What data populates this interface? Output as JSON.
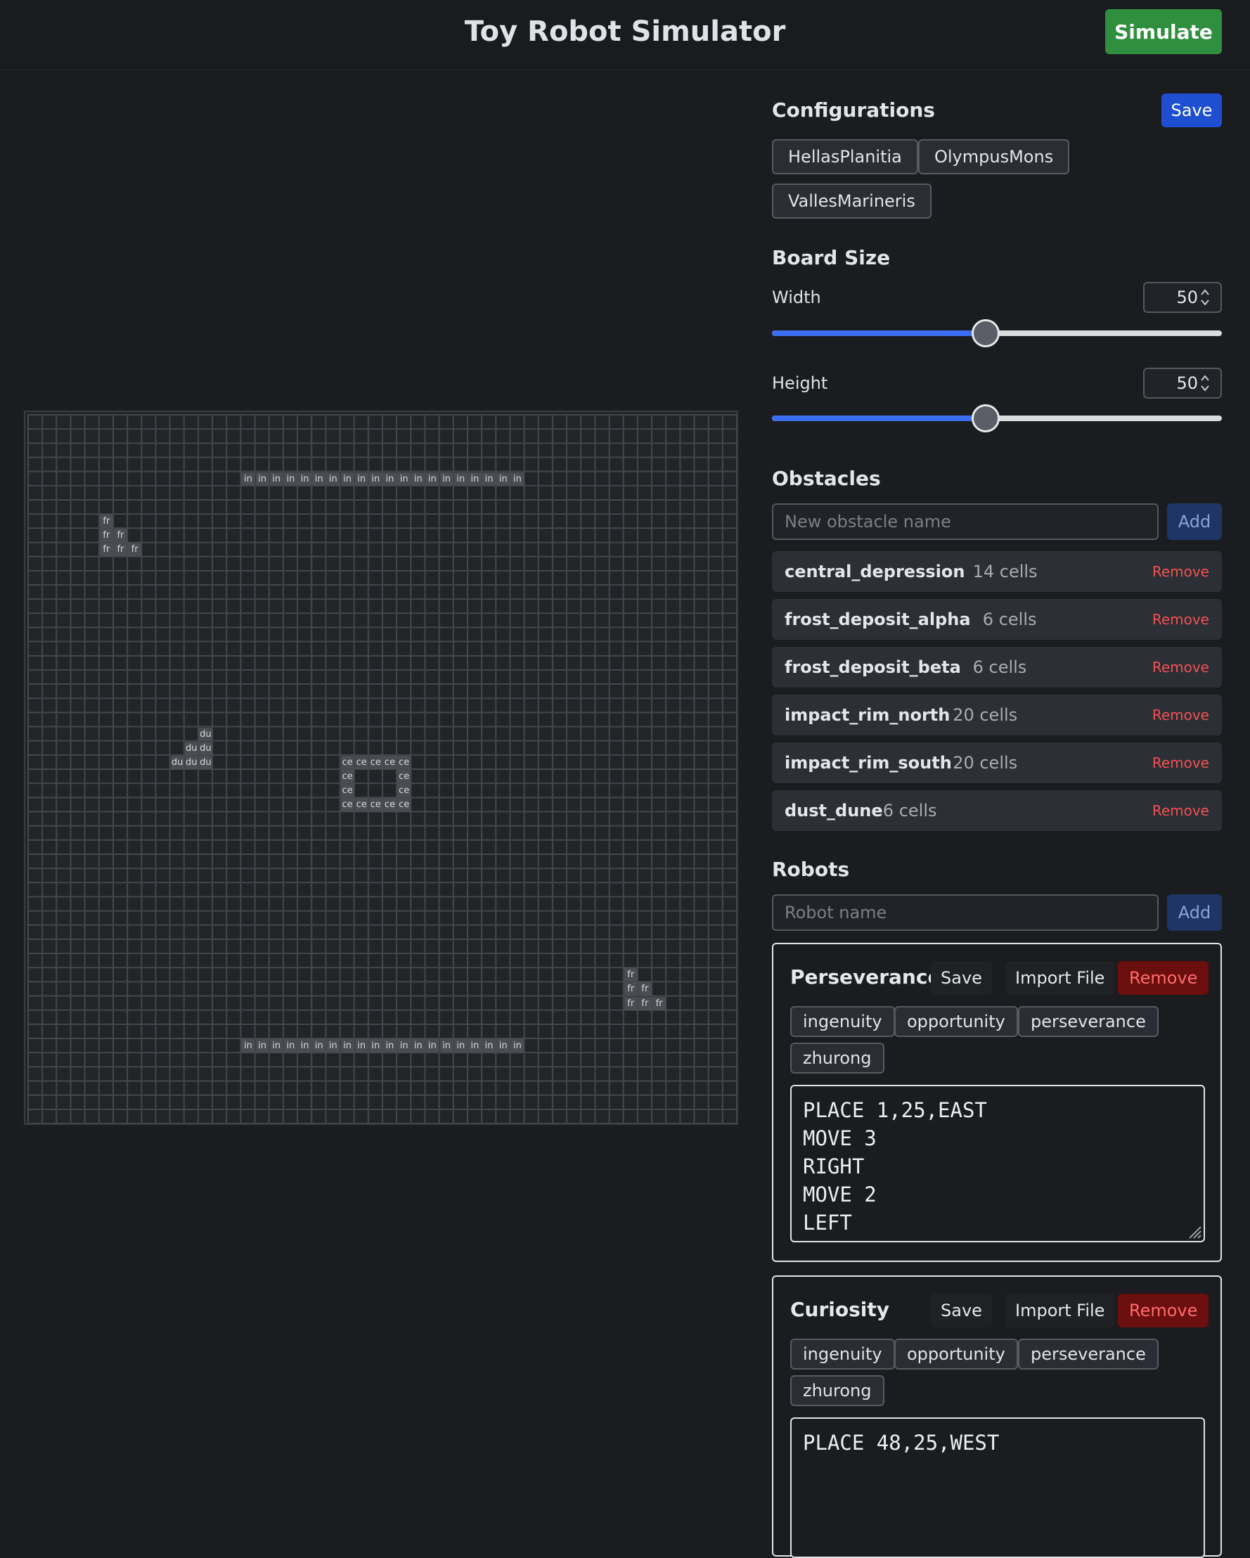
{
  "app": {
    "title": "Toy Robot Simulator",
    "simulate_label": "Simulate"
  },
  "configurations": {
    "title": "Configurations",
    "save_label": "Save",
    "items": [
      "HellasPlanitia",
      "OlympusMons",
      "VallesMarineris"
    ]
  },
  "board_size": {
    "title": "Board Size",
    "width_label": "Width",
    "width_value": "50",
    "width_fraction": 0.475,
    "height_label": "Height",
    "height_value": "50",
    "height_fraction": 0.475
  },
  "obstacles": {
    "title": "Obstacles",
    "placeholder": "New obstacle name",
    "add_label": "Add",
    "remove_label": "Remove",
    "items": [
      {
        "name": "central_depression",
        "count": "14 cells"
      },
      {
        "name": "frost_deposit_alpha",
        "count": "6 cells"
      },
      {
        "name": "frost_deposit_beta",
        "count": "6 cells"
      },
      {
        "name": "impact_rim_north",
        "count": "20 cells"
      },
      {
        "name": "impact_rim_south",
        "count": "20 cells"
      },
      {
        "name": "dust_dune",
        "count": "6 cells"
      }
    ]
  },
  "robots": {
    "title": "Robots",
    "placeholder": "Robot name",
    "add_label": "Add",
    "save_label": "Save",
    "import_label": "Import File",
    "remove_label": "Remove",
    "tags": [
      "ingenuity",
      "opportunity",
      "perseverance",
      "zhurong"
    ],
    "items": [
      {
        "name": "Perseverance",
        "commands": "PLACE 1,25,EAST\nMOVE 3\nRIGHT\nMOVE 2\nLEFT"
      },
      {
        "name": "Curiosity",
        "commands": "PLACE 48,25,WEST"
      }
    ]
  },
  "board": {
    "grid_size": 50,
    "obstacle_cells": [
      {
        "label": "in",
        "cells": [
          [
            15,
            4
          ],
          [
            16,
            4
          ],
          [
            17,
            4
          ],
          [
            18,
            4
          ],
          [
            19,
            4
          ],
          [
            20,
            4
          ],
          [
            21,
            4
          ],
          [
            22,
            4
          ],
          [
            23,
            4
          ],
          [
            24,
            4
          ],
          [
            25,
            4
          ],
          [
            26,
            4
          ],
          [
            27,
            4
          ],
          [
            28,
            4
          ],
          [
            29,
            4
          ],
          [
            30,
            4
          ],
          [
            31,
            4
          ],
          [
            32,
            4
          ],
          [
            33,
            4
          ],
          [
            34,
            4
          ]
        ]
      },
      {
        "label": "in",
        "cells": [
          [
            15,
            44
          ],
          [
            16,
            44
          ],
          [
            17,
            44
          ],
          [
            18,
            44
          ],
          [
            19,
            44
          ],
          [
            20,
            44
          ],
          [
            21,
            44
          ],
          [
            22,
            44
          ],
          [
            23,
            44
          ],
          [
            24,
            44
          ],
          [
            25,
            44
          ],
          [
            26,
            44
          ],
          [
            27,
            44
          ],
          [
            28,
            44
          ],
          [
            29,
            44
          ],
          [
            30,
            44
          ],
          [
            31,
            44
          ],
          [
            32,
            44
          ],
          [
            33,
            44
          ],
          [
            34,
            44
          ]
        ]
      },
      {
        "label": "fr",
        "cells": [
          [
            5,
            7
          ],
          [
            5,
            8
          ],
          [
            6,
            8
          ],
          [
            5,
            9
          ],
          [
            6,
            9
          ],
          [
            7,
            9
          ]
        ]
      },
      {
        "label": "fr",
        "cells": [
          [
            42,
            39
          ],
          [
            42,
            40
          ],
          [
            43,
            40
          ],
          [
            42,
            41
          ],
          [
            43,
            41
          ],
          [
            44,
            41
          ]
        ]
      },
      {
        "label": "du",
        "cells": [
          [
            12,
            22
          ],
          [
            11,
            23
          ],
          [
            12,
            23
          ],
          [
            10,
            24
          ],
          [
            11,
            24
          ],
          [
            12,
            24
          ]
        ]
      },
      {
        "label": "ce",
        "cells": [
          [
            22,
            24
          ],
          [
            23,
            24
          ],
          [
            24,
            24
          ],
          [
            25,
            24
          ],
          [
            26,
            24
          ],
          [
            22,
            25
          ],
          [
            26,
            25
          ],
          [
            22,
            26
          ],
          [
            26,
            26
          ],
          [
            22,
            27
          ],
          [
            23,
            27
          ],
          [
            24,
            27
          ],
          [
            25,
            27
          ],
          [
            26,
            27
          ]
        ]
      }
    ]
  }
}
